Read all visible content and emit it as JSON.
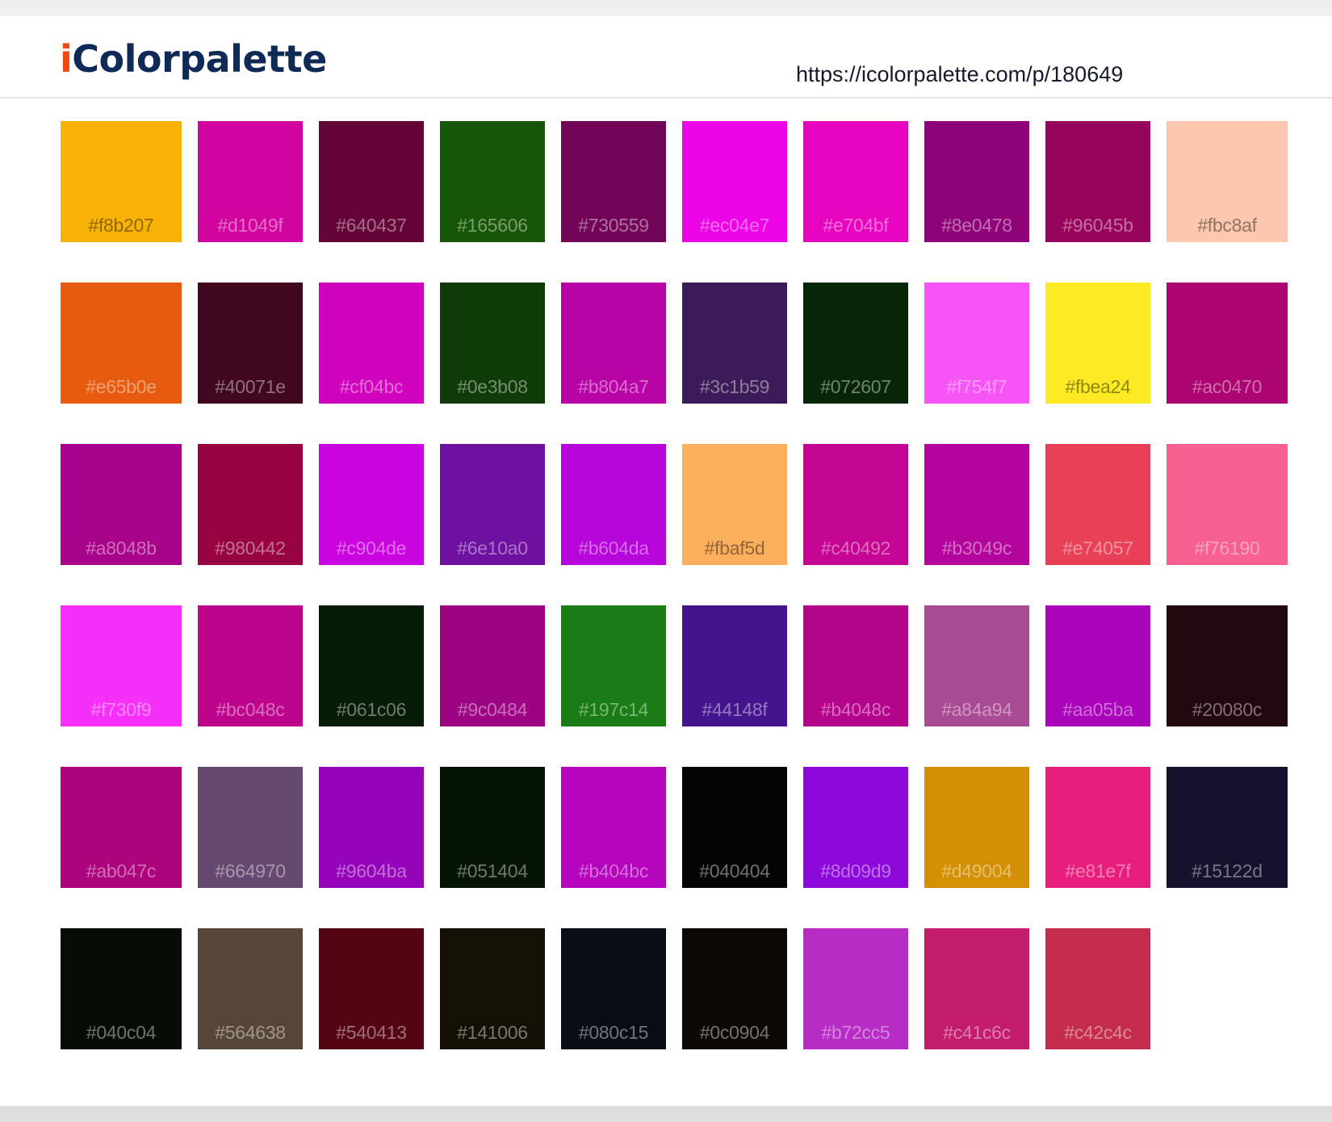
{
  "header": {
    "logo_i": "i",
    "logo_rest": "Colorpalette",
    "url": "https://icolorpalette.com/p/180649"
  },
  "rows": [
    [
      "#f8b207",
      "#d1049f",
      "#640437",
      "#165606",
      "#730559",
      "#ec04e7",
      "#e704bf",
      "#8e0478",
      "#96045b",
      "#fbc8af"
    ],
    [
      "#e65b0e",
      "#40071e",
      "#cf04bc",
      "#0e3b08",
      "#b804a7",
      "#3c1b59",
      "#072607",
      "#f754f7",
      "#fbea24",
      "#ac0470"
    ],
    [
      "#a8048b",
      "#980442",
      "#c904de",
      "#6e10a0",
      "#b604da",
      "#fbaf5d",
      "#c40492",
      "#b3049c",
      "#e74057",
      "#f76190"
    ],
    [
      "#f730f9",
      "#bc048c",
      "#061c06",
      "#9c0484",
      "#197c14",
      "#44148f",
      "#b4048c",
      "#a84a94",
      "#aa05ba",
      "#20080c"
    ],
    [
      "#ab047c",
      "#664970",
      "#9604ba",
      "#051404",
      "#b404bc",
      "#040404",
      "#8d09d9",
      "#d49004",
      "#e81e7f",
      "#15122d"
    ],
    [
      "#040c04",
      "#564638",
      "#540413",
      "#141006",
      "#080c15",
      "#0c0904",
      "#b72cc5",
      "#c41c6c",
      "#c42c4c"
    ]
  ]
}
